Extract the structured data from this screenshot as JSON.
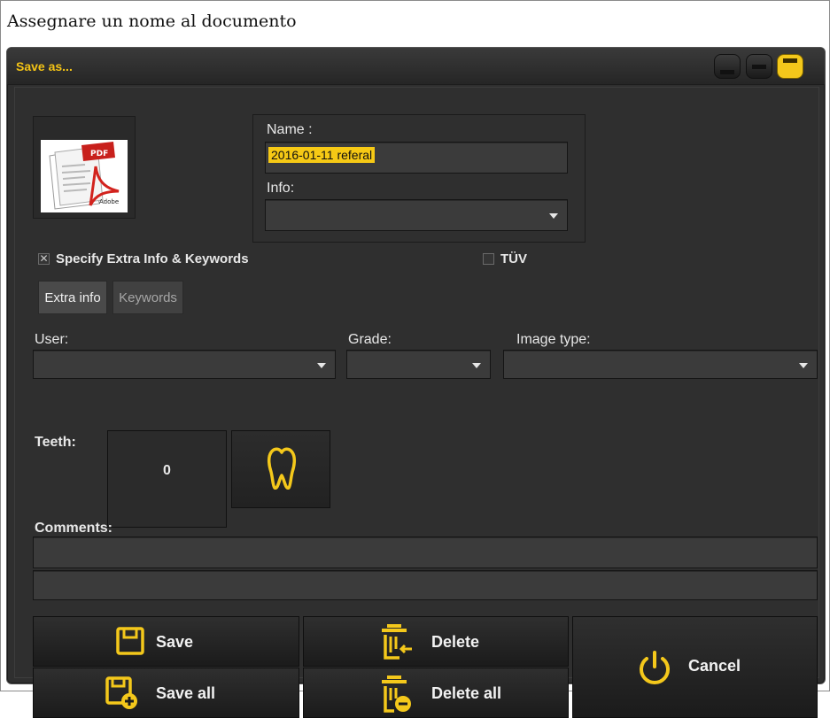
{
  "caption": "Assegnare un nome al documento",
  "window": {
    "title": "Save as...",
    "controls": [
      "minimize-icon",
      "restore-icon",
      "maximize-icon"
    ]
  },
  "thumbnail": {
    "badge": "PDF",
    "brand": "Adobe"
  },
  "name": {
    "label": "Name :",
    "value": "2016-01-11  referal"
  },
  "info": {
    "label": "Info:",
    "value": ""
  },
  "extra": {
    "checkbox_label": "Specify Extra Info & Keywords",
    "checked": true
  },
  "tuv": {
    "label": "TÜV",
    "checked": false
  },
  "tabs": {
    "extra_info": "Extra info",
    "keywords": "Keywords"
  },
  "user": {
    "label": "User:",
    "value": ""
  },
  "grade": {
    "label": "Grade:",
    "value": ""
  },
  "image_type": {
    "label": "Image type:",
    "value": ""
  },
  "teeth": {
    "label": "Teeth:",
    "count": "0"
  },
  "comments": {
    "label": "Comments:",
    "line1": "",
    "line2": ""
  },
  "actions": {
    "save": "Save",
    "save_all": "Save all",
    "delete": "Delete",
    "delete_all": "Delete all",
    "cancel": "Cancel"
  },
  "colors": {
    "accent": "#f4c81b",
    "dialog_bg": "#2f2f2f",
    "field_bg": "#3b3b3b"
  }
}
